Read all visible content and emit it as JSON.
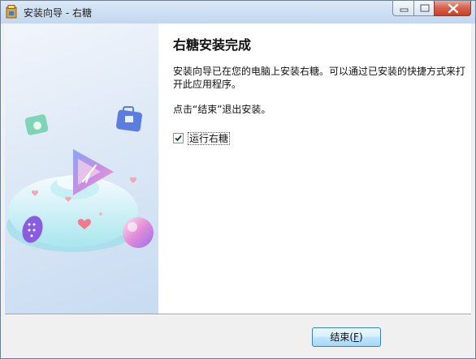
{
  "window": {
    "title": "安装向导 - 右糖",
    "app_icon": "package-icon",
    "controls": {
      "minimize": "minimize-icon",
      "maximize": "maximize-icon",
      "close": "close-icon"
    }
  },
  "sidebar": {
    "illustration": "app-logo-illustration",
    "icons": [
      "camera-icon",
      "briefcase-icon",
      "keypad-icon",
      "gradient-orb-icon",
      "heart-icon"
    ]
  },
  "main": {
    "heading": "右糖安装完成",
    "description": "安装向导已在您的电脑上安装右糖。可以通过已安装的快捷方式来打开此应用程序。",
    "instruction": "点击“结束”退出安装。",
    "run_option": {
      "label": "运行右糖",
      "checked": true
    }
  },
  "footer": {
    "finish_button": {
      "label_prefix": "结束(",
      "accelerator": "F",
      "label_suffix": ")"
    }
  },
  "colors": {
    "accent": "#3c7fb1",
    "close_button": "#c5402b",
    "sidebar": "#c8dbf2"
  }
}
